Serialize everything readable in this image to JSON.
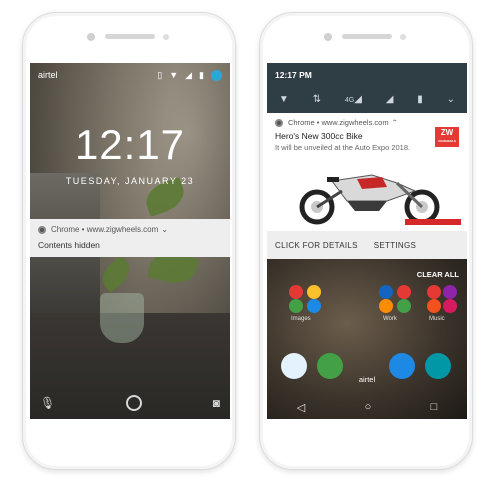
{
  "left_phone": {
    "status_bar": {
      "carrier": "airtel"
    },
    "clock": "12:17",
    "date": "TUESDAY, JANUARY 23",
    "notification": {
      "source": "Chrome • www.zigwheels.com",
      "body": "Contents hidden"
    },
    "icons": [
      "vibrate-icon",
      "wifi-icon",
      "signal-icon",
      "battery-icon",
      "avatar",
      "mic-icon",
      "fingerprint-icon",
      "camera-icon"
    ]
  },
  "right_phone": {
    "status_bar": {
      "time": "12:17 PM"
    },
    "quick_settings": {
      "network": "4G"
    },
    "notification": {
      "source": "Chrome • www.zigwheels.com",
      "title": "Hero's New 300cc Bike",
      "subtitle": "It will be unveiled at the Auto Expo 2018.",
      "brand_logo": "ZW",
      "brand_text": "ZIGWHEELS"
    },
    "actions": {
      "details": "CLICK FOR DETAILS",
      "settings": "SETTINGS"
    },
    "home": {
      "clear_all": "CLEAR ALL",
      "app_labels": [
        "Images",
        "Work",
        "Music"
      ],
      "carrier": "airtel"
    },
    "colors": {
      "status_bar": "#2f3d44",
      "brand_red": "#e53935"
    }
  }
}
